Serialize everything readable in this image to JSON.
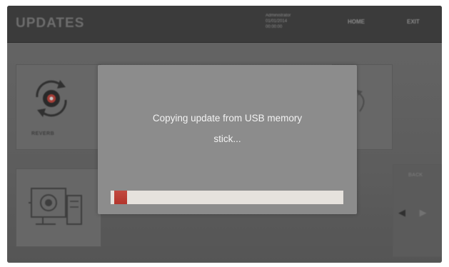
{
  "window": {
    "title": "UPDATES"
  },
  "header": {
    "user_lines": [
      "Administrator",
      "01/01/2014",
      "00:00:00"
    ],
    "home_label": "HOME",
    "exit_label": "EXIT"
  },
  "background": {
    "tile_label": "REVERB",
    "back_label": "BACK",
    "nav_prev": "◀",
    "nav_next": "▶"
  },
  "dialog": {
    "message_line1": "Copying update from USB memory",
    "message_line2": "stick...",
    "progress_fraction": 0.07,
    "progress_color": "#b3352c",
    "track_color": "#e6e2dd"
  },
  "icons": {
    "refresh": "refresh-icon",
    "device": "monitor-device-icon",
    "arrow": "arrow-right-icon"
  }
}
